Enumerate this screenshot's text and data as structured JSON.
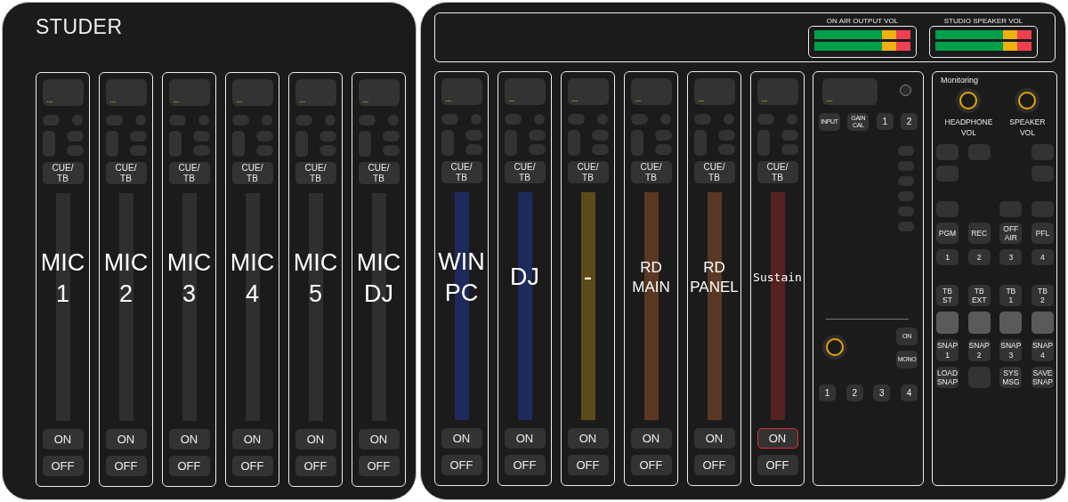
{
  "left_panel": {
    "title": "STUDER",
    "channels": [
      {
        "display": "...",
        "cue_button": "CUE/\nTB",
        "label": "MIC\n1",
        "color": "#2f2f2f",
        "on_button": "ON",
        "on_highlighted": false,
        "off_button": "OFF"
      },
      {
        "display": "...",
        "cue_button": "CUE/\nTB",
        "label": "MIC\n2",
        "color": "#2f2f2f",
        "on_button": "ON",
        "on_highlighted": false,
        "off_button": "OFF"
      },
      {
        "display": "...",
        "cue_button": "CUE/\nTB",
        "label": "MIC\n3",
        "color": "#2f2f2f",
        "on_button": "ON",
        "on_highlighted": false,
        "off_button": "OFF"
      },
      {
        "display": "...",
        "cue_button": "CUE/\nTB",
        "label": "MIC\n4",
        "color": "#2f2f2f",
        "on_button": "ON",
        "on_highlighted": false,
        "off_button": "OFF"
      },
      {
        "display": "...",
        "cue_button": "CUE/\nTB",
        "label": "MIC\n5",
        "color": "#2f2f2f",
        "on_button": "ON",
        "on_highlighted": false,
        "off_button": "OFF"
      },
      {
        "display": "...",
        "cue_button": "CUE/\nTB",
        "label": "MIC\nDJ",
        "color": "#2f2f2f",
        "on_button": "ON",
        "on_highlighted": false,
        "off_button": "OFF"
      }
    ]
  },
  "right_panel": {
    "meters": [
      {
        "title": "ON AIR OUTPUT VOL"
      },
      {
        "title": "STUDIO SPEAKER VOL"
      }
    ],
    "channels": [
      {
        "display": "...",
        "cue_button": "CUE/\nTB",
        "label": "WIN\nPC",
        "color": "#1f2a5c",
        "on_button": "ON",
        "on_highlighted": false,
        "off_button": "OFF"
      },
      {
        "display": "...",
        "cue_button": "CUE/\nTB",
        "label": "DJ",
        "color": "#1f2a5c",
        "on_button": "ON",
        "on_highlighted": false,
        "off_button": "OFF"
      },
      {
        "display": "...",
        "cue_button": "CUE/\nTB",
        "label": "-",
        "color": "#5b4a1a",
        "on_button": "ON",
        "on_highlighted": false,
        "off_button": "OFF"
      },
      {
        "display": "...",
        "cue_button": "CUE/\nTB",
        "label": "RD\nMAIN",
        "color": "#5a3823",
        "on_button": "ON",
        "on_highlighted": false,
        "off_button": "OFF"
      },
      {
        "display": "...",
        "cue_button": "CUE/\nTB",
        "label": "RD\nPANEL",
        "color": "#5a3823",
        "on_button": "ON",
        "on_highlighted": false,
        "off_button": "OFF"
      },
      {
        "display": "...",
        "cue_button": "CUE/\nTB",
        "label": "Sustain",
        "color": "#55221f",
        "on_button": "ON",
        "on_highlighted": true,
        "off_button": "OFF"
      }
    ],
    "processor": {
      "display": "...",
      "buttons": [
        "INPUT",
        "GAIN\nCAL",
        "1",
        "2"
      ],
      "toggles": [
        "ON",
        "MONO"
      ],
      "bottom_buttons": [
        "1",
        "2",
        "3",
        "4"
      ]
    },
    "monitoring": {
      "title": "Monitoring",
      "knobs": [
        "HEADPHONE\nVOL",
        "SPEAKER\nVOL"
      ],
      "rows": [
        [
          {
            "kind": "blank"
          },
          {
            "kind": "blank"
          },
          {
            "kind": "empty"
          },
          {
            "kind": "blank"
          }
        ],
        [
          {
            "kind": "blank"
          },
          {
            "kind": "empty"
          },
          {
            "kind": "empty"
          },
          {
            "kind": "blank"
          }
        ],
        [
          {
            "kind": "blank"
          },
          {
            "kind": "empty"
          },
          {
            "kind": "blank"
          },
          {
            "kind": "blank"
          }
        ],
        [
          {
            "kind": "text",
            "text": "PGM"
          },
          {
            "kind": "text",
            "text": "REC"
          },
          {
            "kind": "text",
            "text": "OFF\nAIR"
          },
          {
            "kind": "text",
            "text": "PFL"
          }
        ],
        [
          {
            "kind": "text",
            "text": "1"
          },
          {
            "kind": "text",
            "text": "2"
          },
          {
            "kind": "text",
            "text": "3"
          },
          {
            "kind": "text",
            "text": "4"
          }
        ],
        [
          {
            "kind": "text",
            "text": "TB\nST"
          },
          {
            "kind": "text",
            "text": "TB\nEXT"
          },
          {
            "kind": "text",
            "text": "TB\n1"
          },
          {
            "kind": "text",
            "text": "TB\n2"
          }
        ],
        [
          {
            "kind": "pad"
          },
          {
            "kind": "pad"
          },
          {
            "kind": "pad"
          },
          {
            "kind": "pad"
          }
        ],
        [
          {
            "kind": "text",
            "text": "SNAP\n1"
          },
          {
            "kind": "text",
            "text": "SNAP\n2"
          },
          {
            "kind": "text",
            "text": "SNAP\n3"
          },
          {
            "kind": "text",
            "text": "SNAP\n4"
          }
        ],
        [
          {
            "kind": "text",
            "text": "LOAD\nSNAP"
          },
          {
            "kind": "blank"
          },
          {
            "kind": "text",
            "text": "SYS\nMSG"
          },
          {
            "kind": "text",
            "text": "SAVE\nSNAP"
          }
        ]
      ]
    }
  }
}
